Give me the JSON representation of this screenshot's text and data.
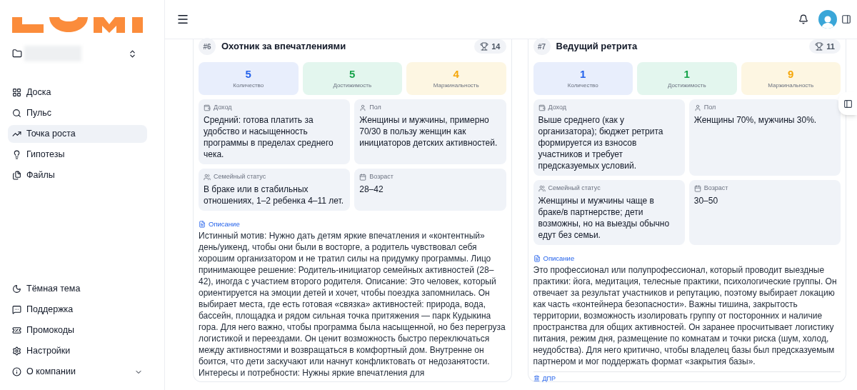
{
  "sidebar": {
    "nav": [
      {
        "label": "Доска",
        "selected": false
      },
      {
        "label": "Пульс",
        "selected": false
      },
      {
        "label": "Точка роста",
        "selected": true
      },
      {
        "label": "Гипотезы",
        "selected": false
      },
      {
        "label": "Файлы",
        "selected": false
      }
    ],
    "footer": [
      {
        "label": "Тёмная тема",
        "kind": "link"
      },
      {
        "label": "Поддержка",
        "kind": "link"
      },
      {
        "label": "Промокоды",
        "kind": "link"
      },
      {
        "label": "Настройки",
        "kind": "link"
      },
      {
        "label": "О компании",
        "kind": "group",
        "expanded": false
      }
    ]
  },
  "personas": [
    {
      "number": "#6",
      "title": "Охотник за впечатлениями",
      "score": "14",
      "metrics": [
        {
          "kind": "quantity",
          "value": "5",
          "label": "Количество"
        },
        {
          "kind": "reach",
          "value": "5",
          "label": "Достижимость"
        },
        {
          "kind": "margin",
          "value": "4",
          "label": "Маржинальность"
        }
      ],
      "fields": [
        {
          "kind": "income",
          "label": "Доход",
          "value": "Средний: готова платить за удобство и насыщенность программы в пределах среднего чека."
        },
        {
          "kind": "gender",
          "label": "Пол",
          "value": "Женщины и мужчины, примерно 70/30 в пользу женщин как инициаторов детских активностей."
        },
        {
          "kind": "family",
          "label": "Семейный статус",
          "value": "В браке или в стабильных отношениях, 1–2 ребенка 4–11 лет."
        },
        {
          "kind": "age",
          "label": "Возраст",
          "value": "28–42"
        }
      ],
      "description": {
        "label": "Описание",
        "text": "Истинный мотив: Нужно дать детям яркие впечатления и «контентный» день/уикенд, чтобы они были в восторге, а родитель чувствовал себя хорошим организатором и не тратил силы на придумку программы. Лицо принимающее решение: Родитель-инициатор семейных активностей (28–42), иногда с участием второго родителя. Описание: Это человек, который ориентируется на эмоции детей и хочет, чтобы поездка запомнилась. Он выбирает места, где есть готовая «связка» активностей: природа, вода, бассейн, площадка и рядом сильная точка притяжения — парк Кудыкина гора. Для него важно, чтобы программа была насыщенной, но без перегруза логистикой и переездами. Он ценит возможность быстро переключаться между активностями и возвращаться в комфортный дом. Внутренне он боится, что дети заскучают или начнут конфликтовать от недозанятости. Интересы и потребности: Нужны яркие впечатления для"
      }
    },
    {
      "number": "#7",
      "title": "Ведущий ретрита",
      "score": "11",
      "metrics": [
        {
          "kind": "quantity",
          "value": "1",
          "label": "Количество"
        },
        {
          "kind": "reach",
          "value": "1",
          "label": "Достижимость"
        },
        {
          "kind": "margin",
          "value": "9",
          "label": "Маржинальность"
        }
      ],
      "fields": [
        {
          "kind": "income",
          "label": "Доход",
          "value": "Выше среднего (как у организатора); бюджет ретрита формируется из взносов участников и требует предсказуемых условий."
        },
        {
          "kind": "gender",
          "label": "Пол",
          "value": "Женщины 70%, мужчины 30%."
        },
        {
          "kind": "family",
          "label": "Семейный статус",
          "value": "Женщины и мужчины чаще в браке/в партнерстве; дети возможны, но на выезды обычно едут без семьи."
        },
        {
          "kind": "age",
          "label": "Возраст",
          "value": "30–50"
        }
      ],
      "description": {
        "label": "Описание",
        "text": "Это профессионал или полупрофессионал, который проводит выездные практики: йога, медитация, телесные практики, психологические группы. Он отвечает за результат участников и репутацию, поэтому выбирает локацию как часть «контейнера безопасности». Важны тишина, закрытость территории, возможность изолировать группу от посторонних и наличие пространства для общих активностей. Он заранее просчитывает логистику питания, режим дня, размещение по комнатам и точки риска (шум, холод, неудобства). Для него критично, чтобы владелец базы был предсказуемым партнером и мог поддержать формат «закрытия базы»."
      },
      "next_section": {
        "label": "ДПР"
      }
    }
  ]
}
